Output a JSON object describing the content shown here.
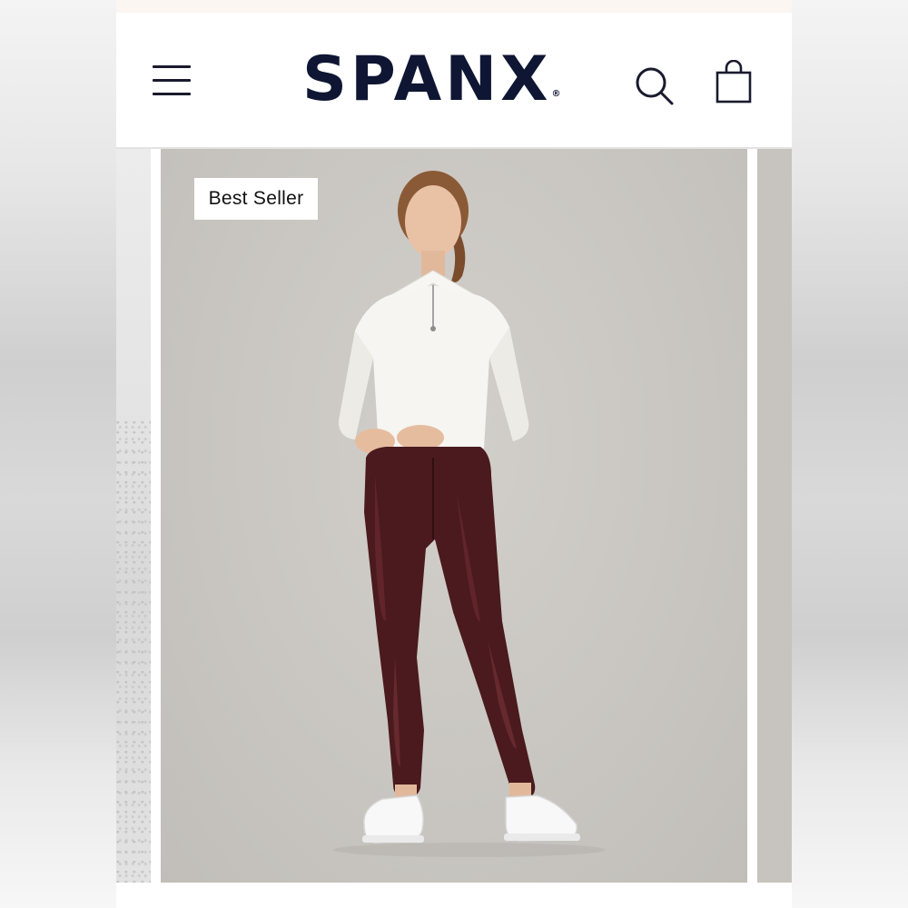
{
  "brand": {
    "name": "SPANX",
    "registered_mark": "®"
  },
  "header": {
    "menu_icon": "hamburger-menu-icon",
    "search_icon": "search-icon",
    "cart_icon": "shopping-bag-icon"
  },
  "hero": {
    "badge_label": "Best Seller",
    "image_description": "model-in-white-half-zip-and-burgundy-leggings"
  },
  "colors": {
    "brand_navy": "#0f1633",
    "photo_background": "#c9c6c1",
    "leggings_burgundy": "#4a1a1e",
    "sweater_white": "#f6f5f1"
  }
}
